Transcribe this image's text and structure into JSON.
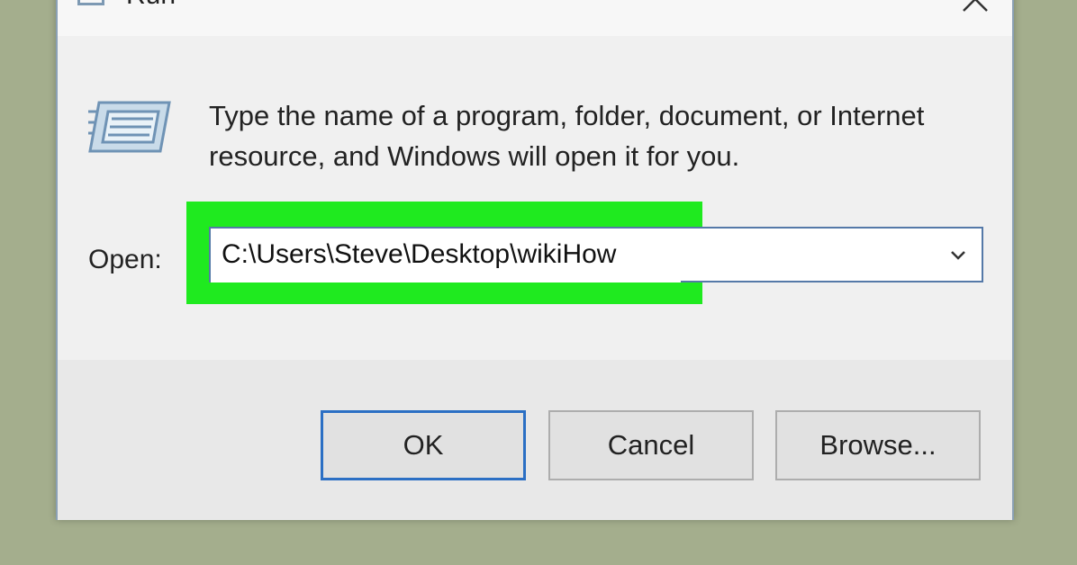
{
  "window": {
    "title": "Run"
  },
  "content": {
    "instructions": "Type the name of a program, folder, document, or Internet resource, and Windows will open it for you.",
    "open_label": "Open:",
    "input_value": "C:\\Users\\Steve\\Desktop\\wikiHow"
  },
  "buttons": {
    "ok": "OK",
    "cancel": "Cancel",
    "browse": "Browse..."
  },
  "colors": {
    "highlight": "#1fea1f",
    "accent_border": "#2b6fc4",
    "backdrop": "#a4ae8d"
  },
  "icons": {
    "title_icon": "run-window-icon",
    "main_icon": "run-program-icon",
    "close_icon": "close-icon",
    "dropdown_icon": "chevron-down-icon"
  }
}
